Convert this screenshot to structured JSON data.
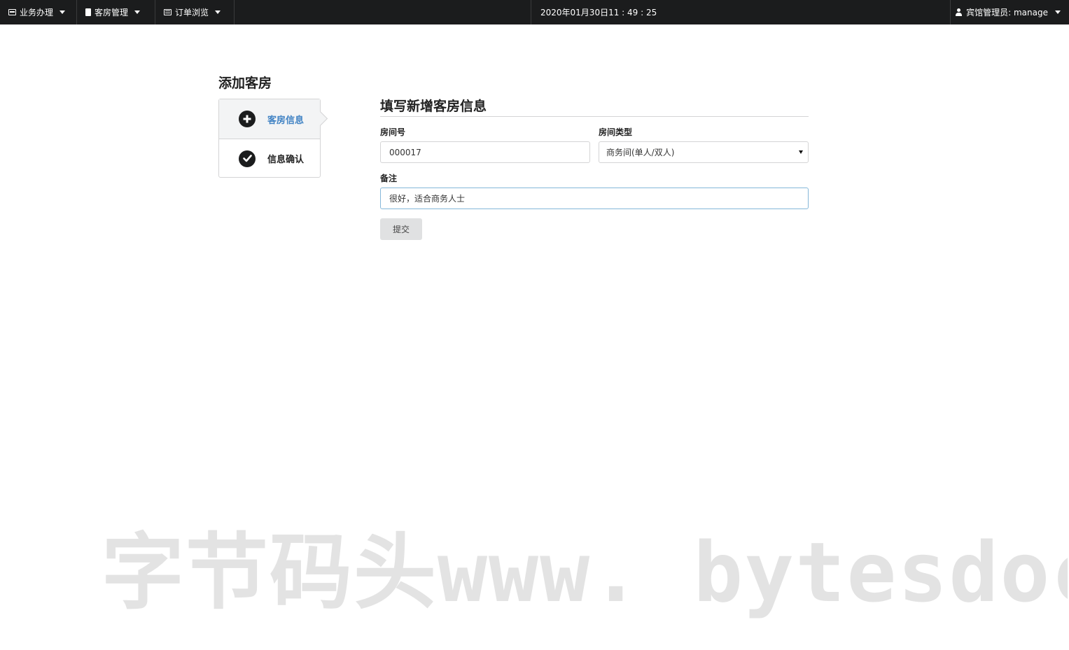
{
  "topbar": {
    "menus": [
      {
        "label": "业务办理",
        "icon": "id-card-icon"
      },
      {
        "label": "客房管理",
        "icon": "building-icon"
      },
      {
        "label": "订单浏览",
        "icon": "list-icon"
      }
    ],
    "datetime": "2020年01月30日11 : 49 : 25",
    "user": "宾馆管理员: manage"
  },
  "page": {
    "title": "添加客房"
  },
  "steps": [
    {
      "label": "客房信息",
      "icon": "plus-circle-icon",
      "active": true
    },
    {
      "label": "信息确认",
      "icon": "check-circle-icon",
      "active": false
    }
  ],
  "form": {
    "header": "填写新增客房信息",
    "room_no_label": "房间号",
    "room_no_value": "000017",
    "room_type_label": "房间类型",
    "room_type_value": "商务间(单人/双人)",
    "note_label": "备注",
    "note_value": "很好，适合商务人士",
    "submit_label": "提交"
  },
  "watermark": "字节码头www. bytesdock.",
  "colors": {
    "topbar_bg": "#1b1c1d",
    "active_step_text": "#4183c4",
    "focus_border": "#85b7d9",
    "button_bg": "#e0e1e2"
  }
}
